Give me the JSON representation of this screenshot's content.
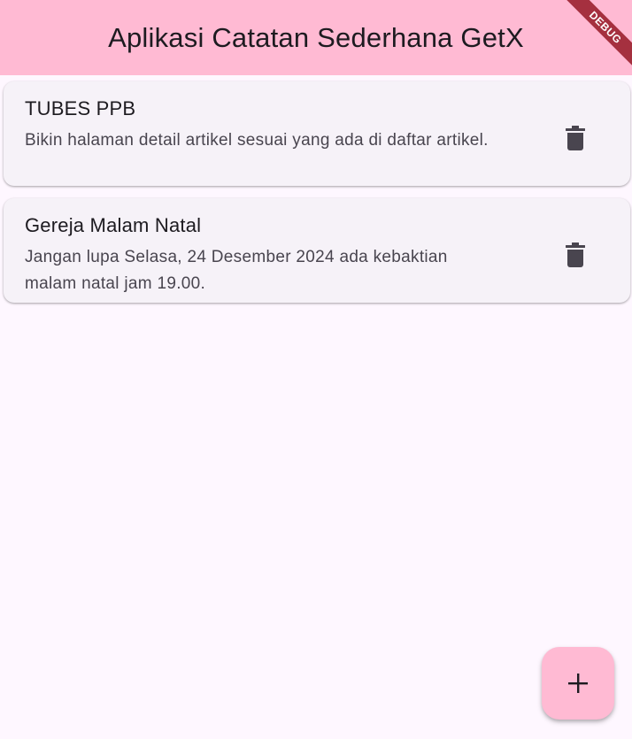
{
  "app_bar": {
    "title": "Aplikasi Catatan Sederhana GetX",
    "background": "#ffbad3"
  },
  "debug_banner": {
    "label": "DEBUG",
    "color": "#a5303f"
  },
  "notes": [
    {
      "title": "TUBES PPB",
      "body": "Bikin halaman detail artikel sesuai yang ada di daftar artikel.",
      "action_icon": "trash-icon"
    },
    {
      "title": "Gereja Malam Natal",
      "body": "Jangan lupa Selasa, 24 Desember 2024 ada kebaktian malam natal jam 19.00.",
      "action_icon": "trash-icon"
    }
  ],
  "fab": {
    "icon": "plus-icon",
    "color": "#ffbad3"
  }
}
